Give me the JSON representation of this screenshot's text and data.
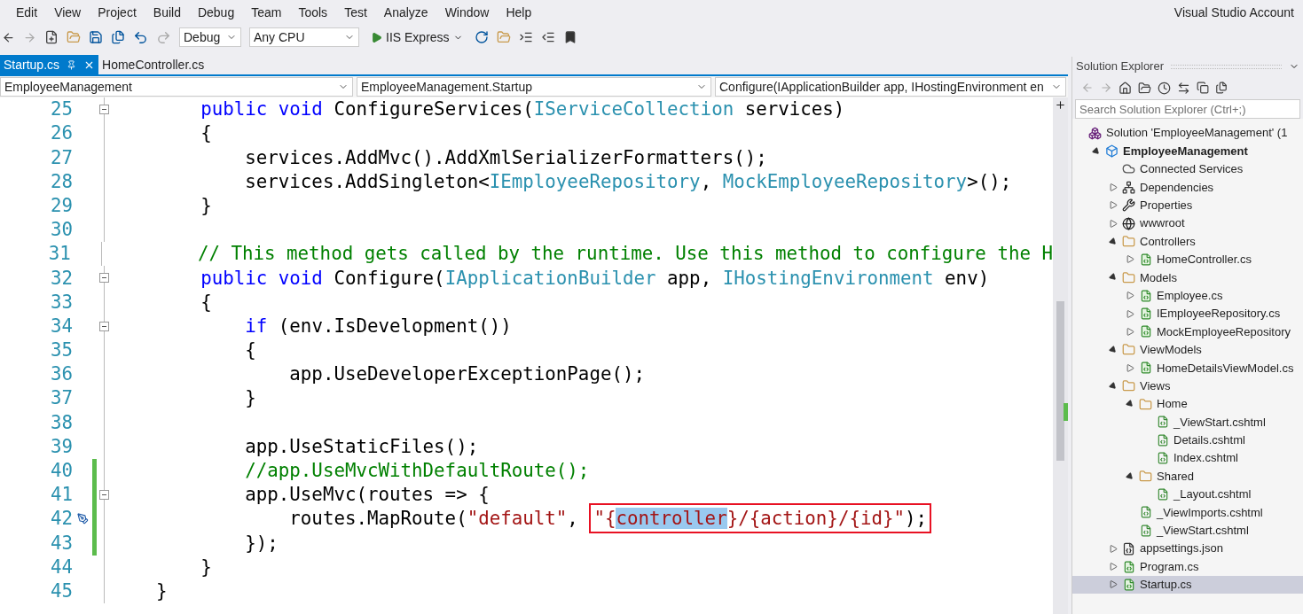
{
  "menu": [
    "Edit",
    "View",
    "Project",
    "Build",
    "Debug",
    "Team",
    "Tools",
    "Test",
    "Analyze",
    "Window",
    "Help"
  ],
  "account": "Visual Studio Account",
  "toolbar": {
    "configuration": "Debug",
    "platform": "Any CPU",
    "run_target": "IIS Express"
  },
  "tabs": [
    {
      "label": "Startup.cs",
      "selected": true
    },
    {
      "label": "HomeController.cs",
      "selected": false
    }
  ],
  "nav_bar": {
    "project": "EmployeeManagement",
    "type": "EmployeeManagement.Startup",
    "member": "Configure(IApplicationBuilder app, IHostingEnvironment en"
  },
  "code_lines": [
    {
      "number": "25",
      "fold": true,
      "changed": false,
      "quick_action": false,
      "tokens": [
        {
          "kind": "keyword",
          "text": "        public void"
        },
        {
          "kind": "plain",
          "text": " ConfigureServices("
        },
        {
          "kind": "type",
          "text": "IServiceCollection"
        },
        {
          "kind": "plain",
          "text": " services)"
        }
      ]
    },
    {
      "number": "26",
      "fold": false,
      "changed": false,
      "quick_action": false,
      "tokens": [
        {
          "kind": "plain",
          "text": "        {"
        }
      ]
    },
    {
      "number": "27",
      "fold": false,
      "changed": false,
      "quick_action": false,
      "tokens": [
        {
          "kind": "plain",
          "text": "            services.AddMvc().AddXmlSerializerFormatters();"
        }
      ]
    },
    {
      "number": "28",
      "fold": false,
      "changed": false,
      "quick_action": false,
      "tokens": [
        {
          "kind": "plain",
          "text": "            services.AddSingleton<"
        },
        {
          "kind": "type",
          "text": "IEmployeeRepository"
        },
        {
          "kind": "plain",
          "text": ", "
        },
        {
          "kind": "type",
          "text": "MockEmployeeRepository"
        },
        {
          "kind": "plain",
          "text": ">();"
        }
      ]
    },
    {
      "number": "29",
      "fold": false,
      "changed": false,
      "quick_action": false,
      "tokens": [
        {
          "kind": "plain",
          "text": "        }"
        }
      ]
    },
    {
      "number": "30",
      "fold": false,
      "changed": false,
      "quick_action": false
    },
    {
      "number": "31",
      "fold": false,
      "changed": false,
      "quick_action": false,
      "tokens": [
        {
          "kind": "comment",
          "text": "        // This method gets called by the runtime. Use this method to configure the H"
        }
      ]
    },
    {
      "number": "32",
      "fold": true,
      "changed": false,
      "quick_action": false,
      "tokens": [
        {
          "kind": "keyword",
          "text": "        public void"
        },
        {
          "kind": "plain",
          "text": " Configure("
        },
        {
          "kind": "type",
          "text": "IApplicationBuilder"
        },
        {
          "kind": "plain",
          "text": " app, "
        },
        {
          "kind": "type",
          "text": "IHostingEnvironment"
        },
        {
          "kind": "plain",
          "text": " env)"
        }
      ]
    },
    {
      "number": "33",
      "fold": false,
      "changed": false,
      "quick_action": false,
      "tokens": [
        {
          "kind": "plain",
          "text": "        {"
        }
      ]
    },
    {
      "number": "34",
      "fold": true,
      "changed": false,
      "quick_action": false,
      "tokens": [
        {
          "kind": "keyword",
          "text": "            if"
        },
        {
          "kind": "plain",
          "text": " (env.IsDevelopment())"
        }
      ]
    },
    {
      "number": "35",
      "fold": false,
      "changed": false,
      "quick_action": false,
      "tokens": [
        {
          "kind": "plain",
          "text": "            {"
        }
      ]
    },
    {
      "number": "36",
      "fold": false,
      "changed": false,
      "quick_action": false,
      "tokens": [
        {
          "kind": "plain",
          "text": "                app.UseDeveloperExceptionPage();"
        }
      ]
    },
    {
      "number": "37",
      "fold": false,
      "changed": false,
      "quick_action": false,
      "tokens": [
        {
          "kind": "plain",
          "text": "            }"
        }
      ]
    },
    {
      "number": "38",
      "fold": false,
      "changed": false,
      "quick_action": false
    },
    {
      "number": "39",
      "fold": false,
      "changed": false,
      "quick_action": false,
      "tokens": [
        {
          "kind": "plain",
          "text": "            app.UseStaticFiles();"
        }
      ]
    },
    {
      "number": "40",
      "fold": false,
      "changed": true,
      "quick_action": false,
      "tokens": [
        {
          "kind": "comment",
          "text": "            //app.UseMvcWithDefaultRoute();"
        }
      ]
    },
    {
      "number": "41",
      "fold": true,
      "changed": true,
      "quick_action": false,
      "tokens": [
        {
          "kind": "plain",
          "text": "            app.UseMvc(routes => {"
        }
      ]
    },
    {
      "number": "42",
      "fold": false,
      "changed": true,
      "quick_action": true,
      "tokens": [
        {
          "kind": "plain",
          "text": "                routes.MapRoute("
        },
        {
          "kind": "string",
          "text": "\"default\""
        },
        {
          "kind": "plain",
          "text": ", "
        }
      ],
      "boxed_tokens": [
        {
          "kind": "string",
          "text": "\"{"
        },
        {
          "kind": "selection",
          "text": "controller"
        },
        {
          "kind": "string",
          "text": "}/{action}/{id}\""
        },
        {
          "kind": "plain",
          "text": ");"
        }
      ]
    },
    {
      "number": "43",
      "fold": false,
      "changed": true,
      "quick_action": false,
      "tokens": [
        {
          "kind": "plain",
          "text": "            });"
        }
      ]
    },
    {
      "number": "44",
      "fold": false,
      "changed": false,
      "quick_action": false,
      "tokens": [
        {
          "kind": "plain",
          "text": "        }"
        }
      ]
    },
    {
      "number": "45",
      "fold": false,
      "changed": false,
      "quick_action": false,
      "tokens": [
        {
          "kind": "plain",
          "text": "    }"
        }
      ]
    }
  ],
  "solution_explorer": {
    "title": "Solution Explorer",
    "search": {
      "placeholder": "Search Solution Explorer (Ctrl+;)"
    },
    "tree": [
      {
        "label": "Solution 'EmployeeManagement' (1",
        "kind": "solution",
        "bold": false,
        "selected": false,
        "children": [
          {
            "label": "EmployeeManagement",
            "kind": "project",
            "bold": true,
            "selected": false,
            "expanded": true,
            "children": [
              {
                "label": "Connected Services",
                "kind": "service",
                "bold": false,
                "selected": false
              },
              {
                "label": "Dependencies",
                "kind": "dependencies",
                "bold": false,
                "selected": false,
                "expanded": false
              },
              {
                "label": "Properties",
                "kind": "properties",
                "bold": false,
                "selected": false,
                "expanded": false
              },
              {
                "label": "wwwroot",
                "kind": "webroot",
                "bold": false,
                "selected": false,
                "expanded": false
              },
              {
                "label": "Controllers",
                "kind": "folder",
                "bold": false,
                "selected": false,
                "expanded": true,
                "children": [
                  {
                    "label": "HomeController.cs",
                    "kind": "csharp",
                    "bold": false,
                    "selected": false,
                    "expanded": false
                  }
                ]
              },
              {
                "label": "Models",
                "kind": "folder",
                "bold": false,
                "selected": false,
                "expanded": true,
                "children": [
                  {
                    "label": "Employee.cs",
                    "kind": "csharp",
                    "bold": false,
                    "selected": false,
                    "expanded": false
                  },
                  {
                    "label": "IEmployeeRepository.cs",
                    "kind": "csharp",
                    "bold": false,
                    "selected": false,
                    "expanded": false
                  },
                  {
                    "label": "MockEmployeeRepository",
                    "kind": "csharp",
                    "bold": false,
                    "selected": false,
                    "expanded": false
                  }
                ]
              },
              {
                "label": "ViewModels",
                "kind": "folder",
                "bold": false,
                "selected": false,
                "expanded": true,
                "children": [
                  {
                    "label": "HomeDetailsViewModel.cs",
                    "kind": "csharp",
                    "bold": false,
                    "selected": false,
                    "expanded": false
                  }
                ]
              },
              {
                "label": "Views",
                "kind": "folder",
                "bold": false,
                "selected": false,
                "expanded": true,
                "children": [
                  {
                    "label": "Home",
                    "kind": "folder",
                    "bold": false,
                    "selected": false,
                    "expanded": true,
                    "children": [
                      {
                        "label": "_ViewStart.cshtml",
                        "kind": "razor",
                        "bold": false,
                        "selected": false
                      },
                      {
                        "label": "Details.cshtml",
                        "kind": "razor",
                        "bold": false,
                        "selected": false
                      },
                      {
                        "label": "Index.cshtml",
                        "kind": "razor",
                        "bold": false,
                        "selected": false
                      }
                    ]
                  },
                  {
                    "label": "Shared",
                    "kind": "folder",
                    "bold": false,
                    "selected": false,
                    "expanded": true,
                    "children": [
                      {
                        "label": "_Layout.cshtml",
                        "kind": "razor",
                        "bold": false,
                        "selected": false
                      }
                    ]
                  },
                  {
                    "label": "_ViewImports.cshtml",
                    "kind": "razor",
                    "bold": false,
                    "selected": false
                  },
                  {
                    "label": "_ViewStart.cshtml",
                    "kind": "razor",
                    "bold": false,
                    "selected": false
                  }
                ]
              },
              {
                "label": "appsettings.json",
                "kind": "json",
                "bold": false,
                "selected": false,
                "expanded": false
              },
              {
                "label": "Program.cs",
                "kind": "csharp",
                "bold": false,
                "selected": false,
                "expanded": false
              },
              {
                "label": "Startup.cs",
                "kind": "csharp",
                "bold": false,
                "selected": true,
                "expanded": false
              }
            ]
          }
        ]
      }
    ]
  }
}
